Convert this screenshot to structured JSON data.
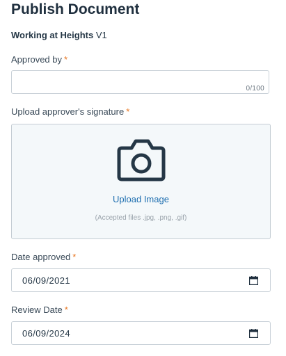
{
  "page": {
    "title": "Publish Document"
  },
  "document": {
    "name": "Working at Heights",
    "version": "V1"
  },
  "form": {
    "required_marker": "*",
    "approved_by": {
      "label": "Approved by",
      "value": "",
      "placeholder": "",
      "counter": "0/100"
    },
    "signature": {
      "label": "Upload approver's signature",
      "icon": "camera-icon",
      "upload_label": "Upload Image",
      "accepted_hint": "(Accepted files .jpg, .png, .gif)"
    },
    "date_approved": {
      "label": "Date approved",
      "value": "06/09/2021",
      "icon": "calendar-icon"
    },
    "review_date": {
      "label": "Review Date",
      "value": "06/09/2024",
      "icon": "calendar-icon"
    }
  },
  "colors": {
    "required": "#e87722",
    "link": "#1f6fb0",
    "upload_background": "#f4f8fa",
    "text": "#253746"
  }
}
